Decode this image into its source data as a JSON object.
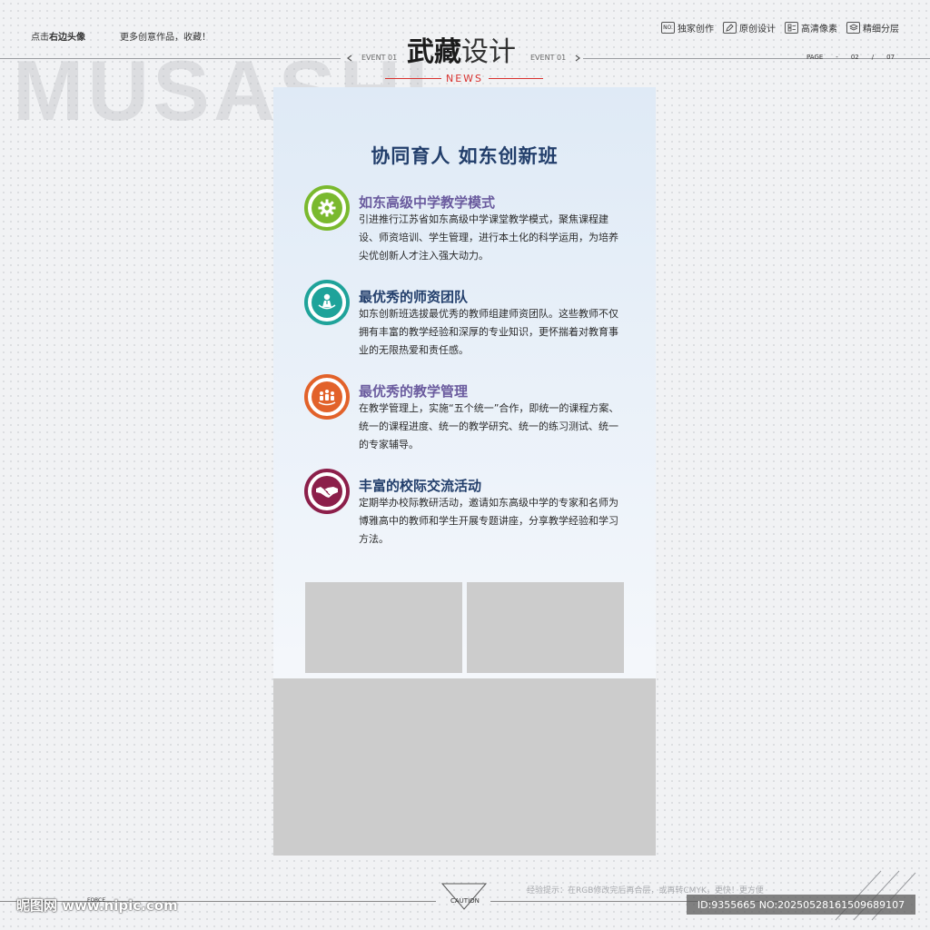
{
  "header": {
    "click_prefix": "点击",
    "click_bold": "右边头像",
    "more": "更多创意作品，收藏！",
    "watermark": "MUSASHI",
    "brand_bold": "武藏",
    "brand_rest": "设计",
    "event_left": "EVENT 01",
    "event_right": "EVENT 01",
    "news": "NEWS",
    "badges": [
      {
        "icon": "no-icon",
        "icon_text": "NO.",
        "label": "独家创作"
      },
      {
        "icon": "pencil-icon",
        "label": "原创设计"
      },
      {
        "icon": "grid-icon",
        "label": "高清像素"
      },
      {
        "icon": "layers-icon",
        "label": "精细分层"
      }
    ],
    "page": {
      "label": "PAGE",
      "dash": "-",
      "current": "02",
      "sep": "/",
      "total": "07"
    }
  },
  "poster": {
    "headline": "协同育人  如东创新班",
    "sections": [
      {
        "icon": "gear-icon",
        "color": "#7ab92e",
        "title_color": "#6a5b9e",
        "title": "如东高级中学教学模式",
        "body": "引进推行江苏省如东高级中学课堂教学模式，聚焦课程建设、师资培训、学生管理，进行本土化的科学运用，为培养尖优创新人才注入强大动力。"
      },
      {
        "icon": "teacher-icon",
        "color": "#1fa39a",
        "title_color": "#223e6b",
        "title": "最优秀的师资团队",
        "body": "如东创新班选拔最优秀的教师组建师资团队。这些教师不仅拥有丰富的教学经验和深厚的专业知识，更怀揣着对教育事业的无限热爱和责任感。"
      },
      {
        "icon": "team-icon",
        "color": "#e2622a",
        "title_color": "#6a5b9e",
        "title": "最优秀的教学管理",
        "body": "在教学管理上，实施“五个统一”合作，即统一的课程方案、统一的课程进度、统一的教学研究、统一的练习测试、统一的专家辅导。"
      },
      {
        "icon": "handshake-icon",
        "color": "#8c1f4a",
        "title_color": "#223e6b",
        "title": "丰富的校际交流活动",
        "body": "定期举办校际教研活动，邀请如东高级中学的专家和名师为博雅高中的教师和学生开展专题讲座，分享教学经验和学习方法。"
      }
    ]
  },
  "footer": {
    "logo": "昵图网 www.nipic.com",
    "force": "FORCE",
    "caution": "CAUTION",
    "tip": "经验提示：在RGB修改完后再合层，或再转CMYK，更快！更方便",
    "id": "ID:9355665 NO:20250528161509689107"
  },
  "colors": {
    "headline": "#223e6b",
    "accent_red": "#d8322f",
    "placeholder": "#cccccc"
  }
}
